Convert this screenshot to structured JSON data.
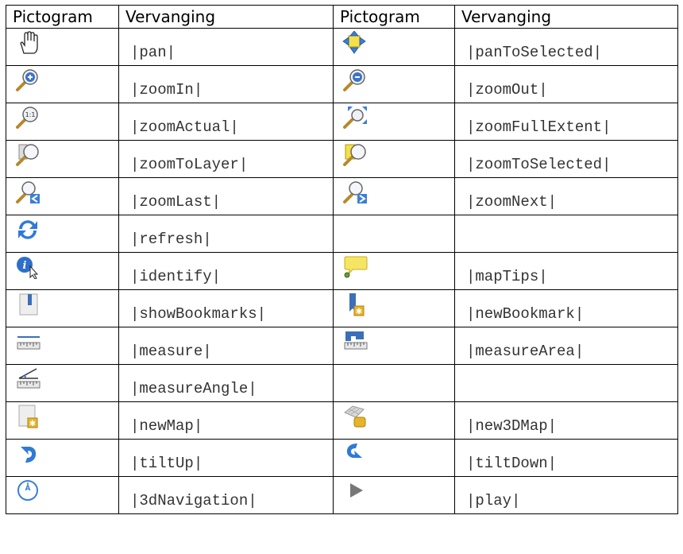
{
  "headers": [
    "Pictogram",
    "Vervanging",
    "Pictogram",
    "Vervanging"
  ],
  "rows": [
    [
      {
        "icon": "hand-pan-icon",
        "text": "|pan|"
      },
      {
        "icon": "pan-to-selected-icon",
        "text": "|panToSelected|"
      }
    ],
    [
      {
        "icon": "zoom-in-icon",
        "text": "|zoomIn|"
      },
      {
        "icon": "zoom-out-icon",
        "text": "|zoomOut|"
      }
    ],
    [
      {
        "icon": "zoom-actual-icon",
        "text": "|zoomActual|"
      },
      {
        "icon": "zoom-full-extent-icon",
        "text": "|zoomFullExtent|"
      }
    ],
    [
      {
        "icon": "zoom-to-layer-icon",
        "text": "|zoomToLayer|"
      },
      {
        "icon": "zoom-to-selected-icon",
        "text": "|zoomToSelected|"
      }
    ],
    [
      {
        "icon": "zoom-last-icon",
        "text": "|zoomLast|"
      },
      {
        "icon": "zoom-next-icon",
        "text": "|zoomNext|"
      }
    ],
    [
      {
        "icon": "refresh-icon",
        "text": "|refresh|"
      },
      {
        "icon": "",
        "text": ""
      }
    ],
    [
      {
        "icon": "identify-icon",
        "text": "|identify|"
      },
      {
        "icon": "map-tips-icon",
        "text": "|mapTips|"
      }
    ],
    [
      {
        "icon": "show-bookmarks-icon",
        "text": "|showBookmarks|"
      },
      {
        "icon": "new-bookmark-icon",
        "text": "|newBookmark|"
      }
    ],
    [
      {
        "icon": "measure-icon",
        "text": "|measure|"
      },
      {
        "icon": "measure-area-icon",
        "text": "|measureArea|"
      }
    ],
    [
      {
        "icon": "measure-angle-icon",
        "text": "|measureAngle|"
      },
      {
        "icon": "",
        "text": ""
      }
    ],
    [
      {
        "icon": "new-map-icon",
        "text": "|newMap|"
      },
      {
        "icon": "new-3d-map-icon",
        "text": "|new3DMap|"
      }
    ],
    [
      {
        "icon": "tilt-up-icon",
        "text": "|tiltUp|"
      },
      {
        "icon": "tilt-down-icon",
        "text": "|tiltDown|"
      }
    ],
    [
      {
        "icon": "3d-navigation-icon",
        "text": "|3dNavigation|"
      },
      {
        "icon": "play-icon",
        "text": "|play|"
      }
    ]
  ]
}
